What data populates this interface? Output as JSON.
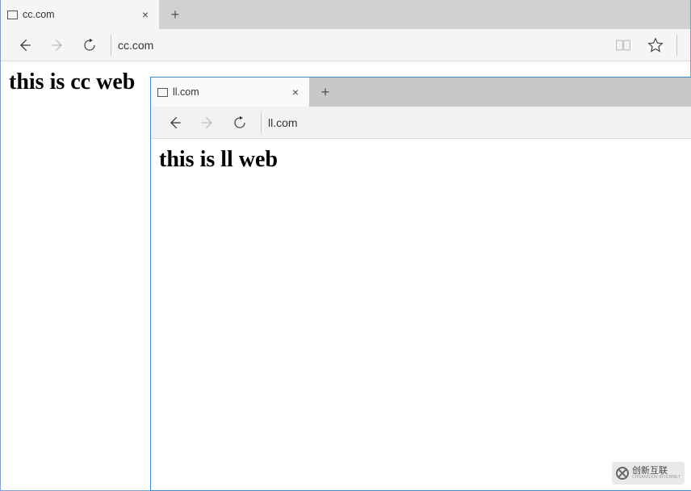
{
  "back": {
    "tab_title": "cc.com",
    "address": "cc.com",
    "page_heading": "this is cc web"
  },
  "front": {
    "tab_title": "ll.com",
    "address": "ll.com",
    "page_heading": "this is ll web"
  },
  "watermark": {
    "line1": "创新互联",
    "line2": "CHUANGXIN INTERNET"
  }
}
